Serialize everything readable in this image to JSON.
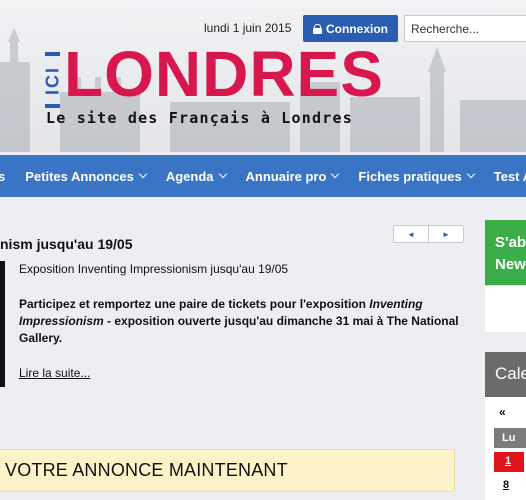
{
  "header": {
    "date": "lundi 1 juin 2015",
    "login_label": "Connexion",
    "search_placeholder": "Recherche...",
    "logo_prefix": "ICI",
    "logo_main": "LONDRES",
    "tagline": "Le site des Français à Londres"
  },
  "nav": {
    "items": [
      "s",
      "Petites Annonces",
      "Agenda",
      "Annuaire pro",
      "Fiches pratiques",
      "Test Ang"
    ]
  },
  "article": {
    "title": "nism jusqu'au 19/05",
    "subtitle": "Exposition Inventing Impressionism jusqu'au 19/05",
    "body_1": "Participez et remportez une paire de tickets pour l'exposition ",
    "body_italic": "Inventing Impressionism",
    "body_2": " - exposition ouverte jusqu'au dimanche 31 mai à The National Gallery.",
    "read_more": "Lire la suite..."
  },
  "pager": {
    "prev": "◄",
    "next": "►"
  },
  "annonce": {
    "text": "VOTRE ANNONCE MAINTENANT"
  },
  "sidebar": {
    "subscribe_line1": "S'ab",
    "subscribe_line2": "New",
    "calendar_title": "Cale",
    "calendar_prev": "«",
    "calendar_day_header": "Lu",
    "calendar_day_1": "1",
    "calendar_day_8": "8"
  },
  "colors": {
    "brand_pink": "#d8174f",
    "brand_blue": "#2a5db0",
    "nav_blue": "#3a74c4",
    "green": "#3cae48",
    "today_red": "#e0141b"
  }
}
